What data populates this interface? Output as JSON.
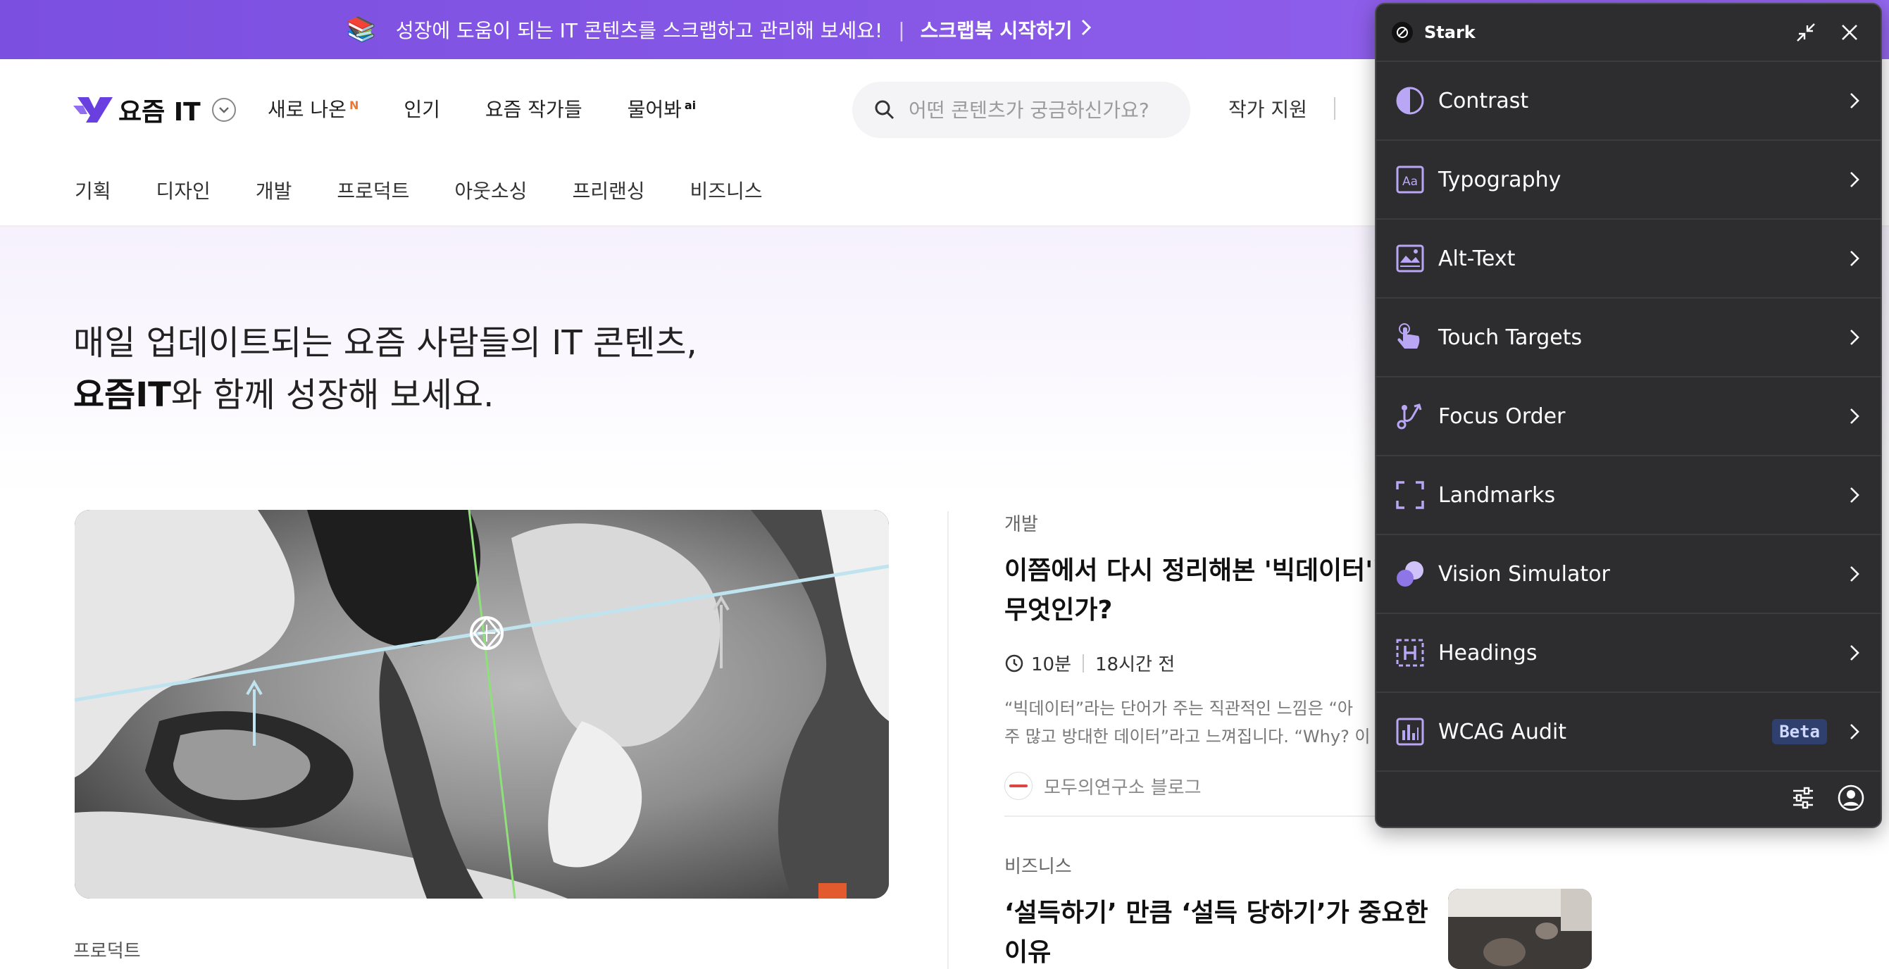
{
  "banner": {
    "icon": "books-emoji",
    "text": "성장에 도움이 되는 IT 콘텐츠를 스크랩하고 관리해 보세요!",
    "divider": "|",
    "cta": "스크랩북 시작하기"
  },
  "header": {
    "logo_text": "요즘 IT",
    "nav": [
      {
        "label": "새로 나온",
        "sup": "N"
      },
      {
        "label": "인기",
        "sup": ""
      },
      {
        "label": "요즘 작가들",
        "sup": ""
      },
      {
        "label": "물어봐",
        "sup": "ai"
      }
    ],
    "search_placeholder": "어떤 콘텐츠가 궁금하신가요?",
    "author_support": "작가 지원",
    "categories": [
      "기획",
      "디자인",
      "개발",
      "프로덕트",
      "아웃소싱",
      "프리랜싱",
      "비즈니스"
    ]
  },
  "hero": {
    "line1": "매일 업데이트되는 요즘 사람들의 IT 콘텐츠,",
    "line2_bold": "요즘IT",
    "line2_rest": "와 함께 성장해 보세요."
  },
  "featured": {
    "category_below": "프로덕트"
  },
  "articles": [
    {
      "category": "개발",
      "title_line1": "이쯤에서 다시 정리해본 '빅데이터'란",
      "title_line2": "무엇인가?",
      "read_time": "10분",
      "posted": "18시간 전",
      "excerpt_line1": "“빅데이터”라는 단어가 주는 직관적인 느낌은 “아",
      "excerpt_line2": "주 많고 방대한 데이터”라고 느껴집니다. “Why? 이",
      "source": "모두의연구소 블로그"
    },
    {
      "category": "비즈니스",
      "title_line1": "‘설득하기’ 만큼 ‘설득 당하기’가 중요한",
      "title_line2": "이유"
    }
  ],
  "stark": {
    "title": "Stark",
    "items": [
      {
        "label": "Contrast",
        "icon": "contrast-icon"
      },
      {
        "label": "Typography",
        "icon": "typography-icon"
      },
      {
        "label": "Alt-Text",
        "icon": "image-alt-icon"
      },
      {
        "label": "Touch Targets",
        "icon": "touch-hand-icon"
      },
      {
        "label": "Focus Order",
        "icon": "focus-order-icon"
      },
      {
        "label": "Landmarks",
        "icon": "landmarks-icon"
      },
      {
        "label": "Vision Simulator",
        "icon": "vision-simulator-icon"
      },
      {
        "label": "Headings",
        "icon": "headings-icon"
      },
      {
        "label": "WCAG Audit",
        "icon": "bar-chart-icon",
        "badge": "Beta"
      }
    ],
    "accent_color": "#b9a6f5"
  },
  "colors": {
    "banner": "#8a5ae8",
    "stark_bg": "#2d2d2f",
    "new_badge": "#f07530"
  }
}
